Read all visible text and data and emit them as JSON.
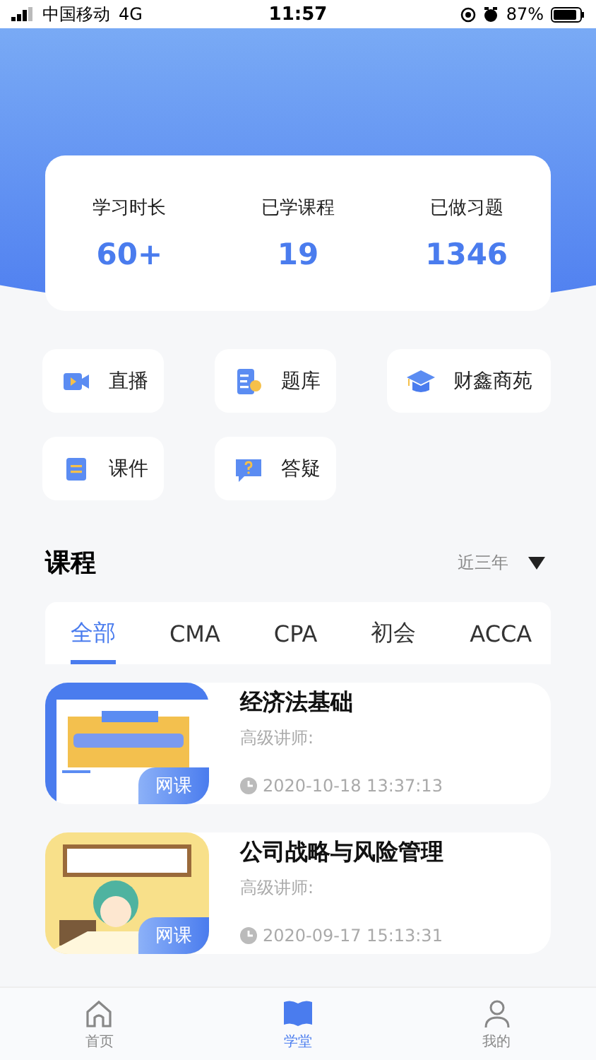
{
  "status_bar": {
    "carrier": "中国移动",
    "network": "4G",
    "time": "11:57",
    "battery": "87%"
  },
  "stats": [
    {
      "label": "学习时长",
      "value": "60+"
    },
    {
      "label": "已学课程",
      "value": "19"
    },
    {
      "label": "已做习题",
      "value": "1346"
    }
  ],
  "shortcuts": [
    {
      "kind": "video",
      "label": "直播"
    },
    {
      "kind": "bank",
      "label": "题库"
    },
    {
      "kind": "cap",
      "label": "财鑫商苑"
    },
    {
      "kind": "file",
      "label": "课件"
    },
    {
      "kind": "question",
      "label": "答疑"
    }
  ],
  "section": {
    "title": "课程",
    "filter": "近三年"
  },
  "tabs": [
    {
      "label": "全部",
      "selected": true
    },
    {
      "label": "CMA",
      "selected": false
    },
    {
      "label": "CPA",
      "selected": false
    },
    {
      "label": "初会",
      "selected": false
    },
    {
      "label": "ACCA",
      "selected": false
    }
  ],
  "courses": [
    {
      "title": "经济法基础",
      "teacher": "高级讲师:",
      "time": "2020-10-18 13:37:13",
      "badge": "网课"
    },
    {
      "title": "公司战略与风险管理",
      "teacher": "高级讲师:",
      "time": "2020-09-17 15:13:31",
      "badge": "网课"
    }
  ],
  "nav": [
    {
      "kind": "home",
      "label": "首页",
      "selected": false
    },
    {
      "kind": "book",
      "label": "学堂",
      "selected": true
    },
    {
      "kind": "person",
      "label": "我的",
      "selected": false
    }
  ]
}
